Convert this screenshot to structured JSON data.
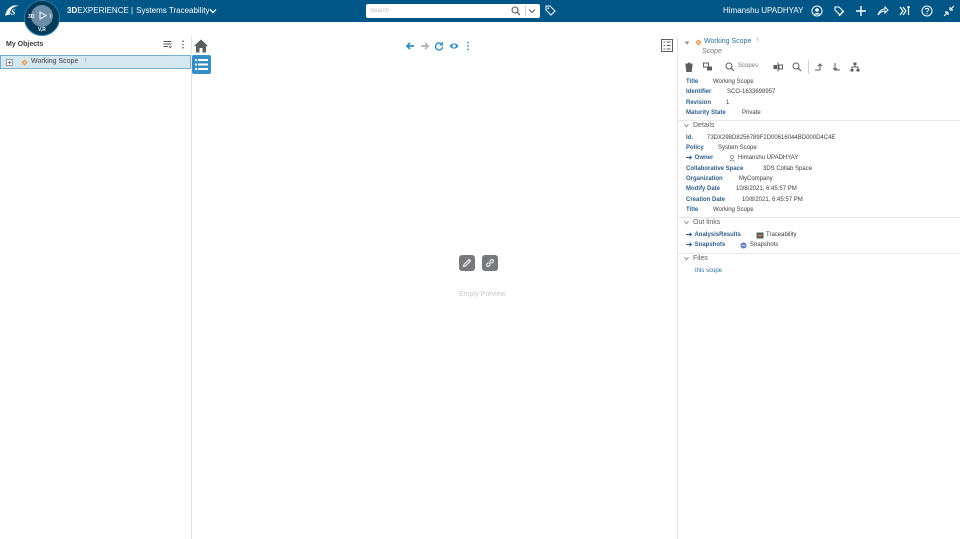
{
  "topbar": {
    "brand_bold": "3D",
    "brand_rest": "EXPERIENCE |",
    "app_name": "Systems Traceability",
    "search_placeholder": "Search",
    "username": "Himanshu UPADHYAY",
    "compass": {
      "top": "3D",
      "left": "V,R",
      "right": "I"
    },
    "icons": [
      "user-icon",
      "tag-icon",
      "add-icon",
      "share-icon",
      "apps-icon",
      "help-icon",
      "collapse-icon"
    ]
  },
  "left_panel": {
    "title": "My Objects",
    "tree_items": [
      {
        "label": "Working Scope",
        "badge": "!"
      }
    ]
  },
  "center": {
    "empty_label": "Empty Preview"
  },
  "right_panel": {
    "title": "Working Scope",
    "title_badge": "!",
    "subtitle": "Scope",
    "toolbar_label": "Scopes",
    "header_props": [
      {
        "key": "Title",
        "value": "Working Scope"
      },
      {
        "key": "Identifier",
        "value": "SCO-1633698957"
      },
      {
        "key": "Revision",
        "value": "1"
      },
      {
        "key": "Maturity State",
        "value": "Private"
      }
    ],
    "details_label": "Details",
    "details": [
      {
        "key": "Id.",
        "value": "73DX298D8256789F2D00616044BD000D4C4E"
      },
      {
        "key": "Policy",
        "value": "System Scope"
      },
      {
        "key": "Owner",
        "value": "Himanshu UPADHYAY"
      },
      {
        "key": "Collaborative Space",
        "value": "3DS Collab Space"
      },
      {
        "key": "Organization",
        "value": "MyCompany"
      },
      {
        "key": "Modify Date",
        "value": "10/8/2021, 6:45:57 PM"
      },
      {
        "key": "Creation Date",
        "value": "10/8/2021, 6:45:57 PM"
      },
      {
        "key": "Title",
        "value": "Working Scope"
      }
    ],
    "outlinks_label": "Out links",
    "outlinks": [
      {
        "key": "AnalysisResults",
        "value": "Traceability"
      },
      {
        "key": "Snapshots",
        "value": "Snapshots"
      }
    ],
    "files_label": "Files",
    "files_value": "this scope"
  },
  "colors": {
    "topbar": "#005686",
    "accent": "#368ec4",
    "selection": "#d5e8f2",
    "link": "#2d6fa3"
  }
}
